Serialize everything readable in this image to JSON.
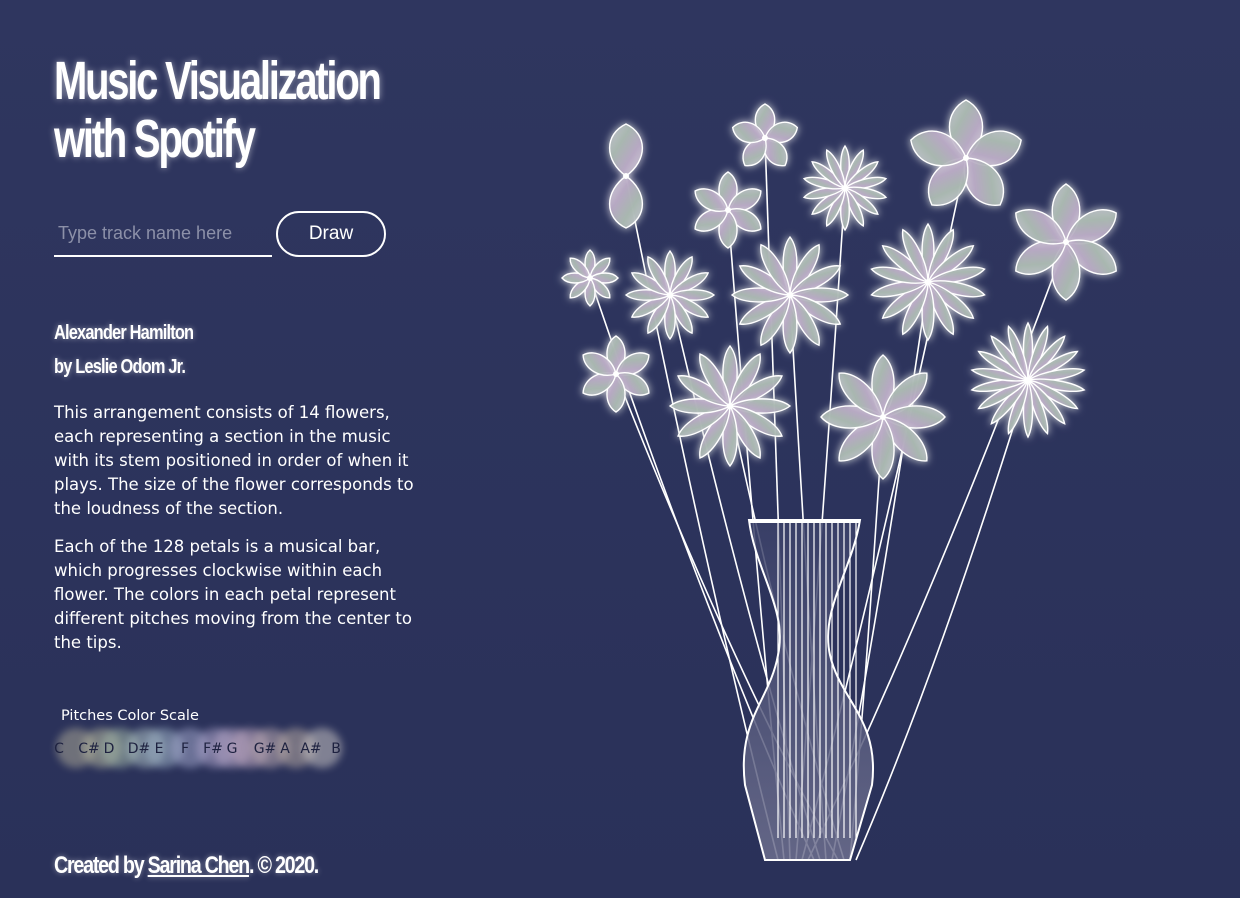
{
  "header": {
    "title_line1": "Music Visualization",
    "title_line2": "with Spotify"
  },
  "search": {
    "placeholder": "Type track name here",
    "value": "",
    "draw_label": "Draw"
  },
  "track": {
    "name": "Alexander Hamilton",
    "artist_line": "by Leslie Odom Jr."
  },
  "description": {
    "paragraph1": "This arrangement consists of 14 flowers, each representing a section in the music with its stem positioned in order of when it plays. The size of the flower corresponds to the loudness of the section.",
    "paragraph2": "Each of the 128 petals is a musical bar, which progresses clockwise within each flower. The colors in each petal represent different pitches moving from the center to the tips."
  },
  "pitch_scale": {
    "title": "Pitches Color Scale",
    "pitches": [
      {
        "label": "C",
        "color": "#a8a595"
      },
      {
        "label": "C#",
        "color": "#b3b59d"
      },
      {
        "label": "D",
        "color": "#9fb4a6"
      },
      {
        "label": "D#",
        "color": "#a9bcc0"
      },
      {
        "label": "E",
        "color": "#9cb0c4"
      },
      {
        "label": "F",
        "color": "#9fa4c8"
      },
      {
        "label": "F#",
        "color": "#a8a0c6"
      },
      {
        "label": "G",
        "color": "#b6a6c6"
      },
      {
        "label": "G#",
        "color": "#c1a9c0"
      },
      {
        "label": "A",
        "color": "#b9a8b0"
      },
      {
        "label": "A#",
        "color": "#b5a8a2"
      },
      {
        "label": "B",
        "color": "#c6c2c2"
      }
    ]
  },
  "footer": {
    "prefix": "Created by ",
    "author": "Sarina Chen",
    "suffix": ". © 2020."
  },
  "visualization": {
    "flower_count": 14,
    "petal_count": 128,
    "flower_petals": [
      2,
      6,
      5,
      14,
      5,
      6,
      8,
      12,
      12,
      14,
      6,
      12,
      8,
      18
    ]
  }
}
